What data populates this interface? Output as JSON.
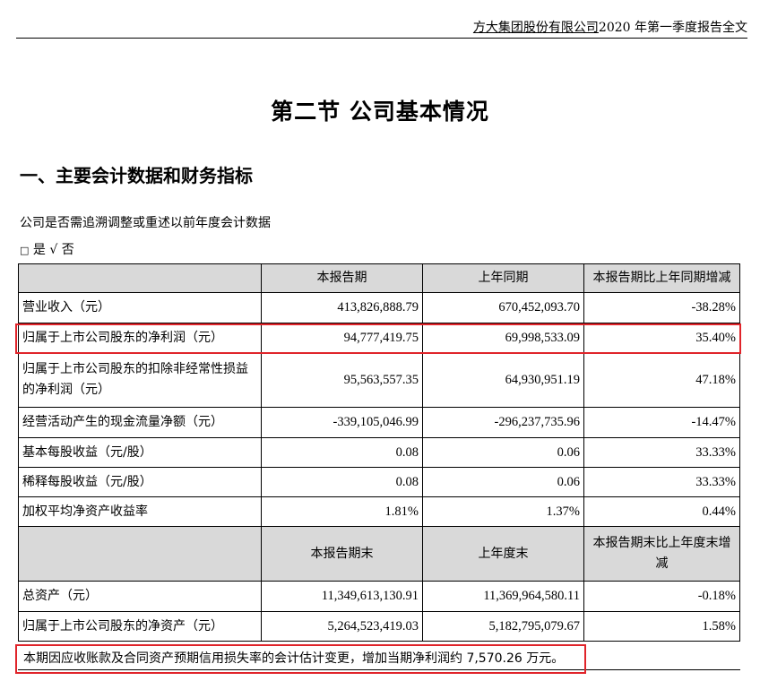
{
  "header": {
    "company": "方大集团股份有限公司",
    "report": "2020 年第一季度报告全文"
  },
  "section_title": "第二节  公司基本情况",
  "heading": "一、主要会计数据和财务指标",
  "question": "公司是否需追溯调整或重述以前年度会计数据",
  "options": {
    "box": "□",
    "yes": "是",
    "check": "√",
    "no": "否"
  },
  "table": {
    "header1": [
      "本报告期",
      "上年同期",
      "本报告期比上年同期增减"
    ],
    "rows1": [
      [
        "营业收入（元）",
        "413,826,888.79",
        "670,452,093.70",
        "-38.28%"
      ],
      [
        "归属于上市公司股东的净利润（元）",
        "94,777,419.75",
        "69,998,533.09",
        "35.40%"
      ],
      [
        "归属于上市公司股东的扣除非经常性损益的净利润（元）",
        "95,563,557.35",
        "64,930,951.19",
        "47.18%"
      ],
      [
        "经营活动产生的现金流量净额（元）",
        "-339,105,046.99",
        "-296,237,735.96",
        "-14.47%"
      ],
      [
        "基本每股收益（元/股）",
        "0.08",
        "0.06",
        "33.33%"
      ],
      [
        "稀释每股收益（元/股）",
        "0.08",
        "0.06",
        "33.33%"
      ],
      [
        "加权平均净资产收益率",
        "1.81%",
        "1.37%",
        "0.44%"
      ]
    ],
    "header2": [
      "本报告期末",
      "上年度末",
      "本报告期末比上年度末增减"
    ],
    "rows2": [
      [
        "总资产（元）",
        "11,349,613,130.91",
        "11,369,964,580.11",
        "-0.18%"
      ],
      [
        "归属于上市公司股东的净资产（元）",
        "5,264,523,419.03",
        "5,182,795,079.67",
        "1.58%"
      ]
    ]
  },
  "note": "本期因应收账款及合同资产预期信用损失率的会计估计变更，增加当期净利润约 7,570.26 万元。",
  "colors": {
    "highlight": "#e0242a",
    "header_bg": "#d9d9d9"
  }
}
